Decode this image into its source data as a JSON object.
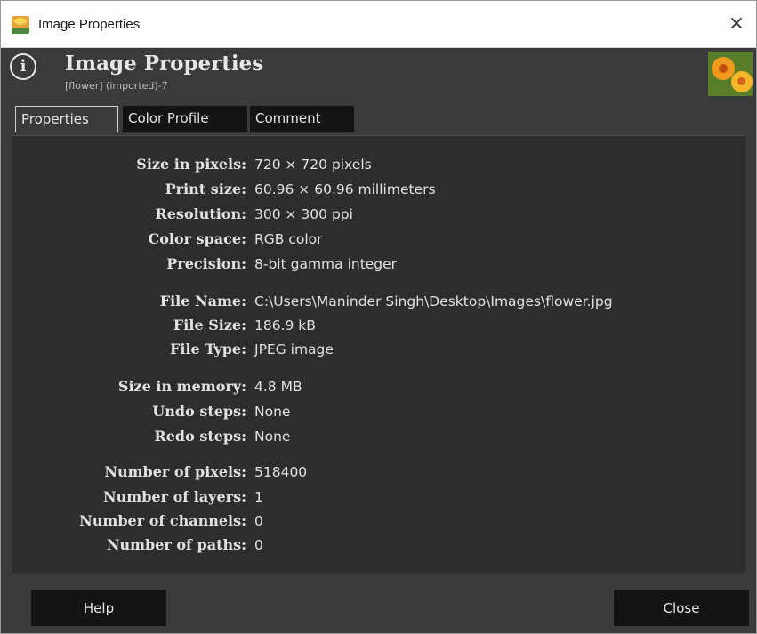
{
  "window": {
    "title": "Image Properties",
    "close_glyph": "×"
  },
  "header": {
    "title": "Image Properties",
    "subtitle": "[flower] (imported)-7",
    "info_icon": "info-icon"
  },
  "tabs": [
    {
      "label": "Properties",
      "active": true
    },
    {
      "label": "Color Profile",
      "active": false
    },
    {
      "label": "Comment",
      "active": false
    }
  ],
  "properties": [
    {
      "label": "Size in pixels:",
      "value": "720 × 720 pixels"
    },
    {
      "label": "Print size:",
      "value": "60.96 × 60.96 millimeters"
    },
    {
      "label": "Resolution:",
      "value": "300 × 300 ppi"
    },
    {
      "label": "Color space:",
      "value": "RGB color"
    },
    {
      "label": "Precision:",
      "value": "8-bit gamma integer"
    },
    {
      "label": "File Name:",
      "value": "C:\\Users\\Maninder Singh\\Desktop\\Images\\flower.jpg"
    },
    {
      "label": "File Size:",
      "value": "186.9 kB"
    },
    {
      "label": "File Type:",
      "value": "JPEG image"
    },
    {
      "label": "Size in memory:",
      "value": "4.8 MB"
    },
    {
      "label": "Undo steps:",
      "value": "None"
    },
    {
      "label": "Redo steps:",
      "value": "None"
    },
    {
      "label": "Number of pixels:",
      "value": "518400"
    },
    {
      "label": "Number of layers:",
      "value": "1"
    },
    {
      "label": "Number of channels:",
      "value": "0"
    },
    {
      "label": "Number of paths:",
      "value": "0"
    }
  ],
  "buttons": {
    "help": "Help",
    "close": "Close"
  },
  "colors": {
    "background": "#3a3a3a",
    "panel": "#2d2d2d",
    "button": "#141414",
    "text": "#e2e2e2"
  }
}
